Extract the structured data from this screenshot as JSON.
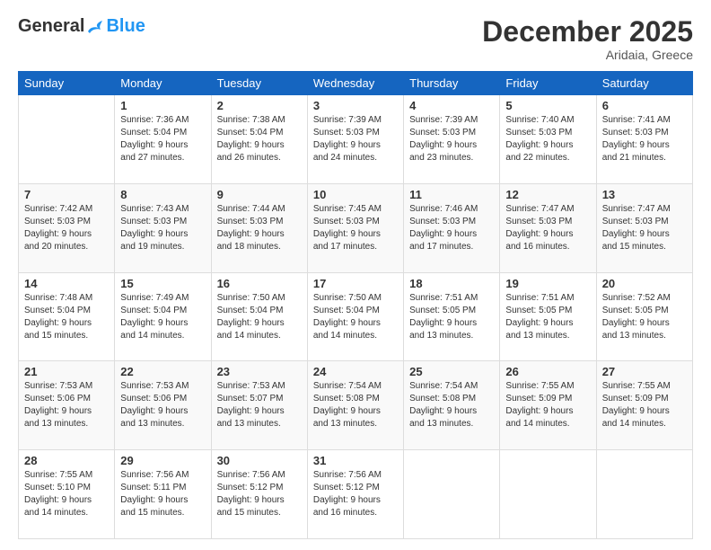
{
  "logo": {
    "general": "General",
    "blue": "Blue"
  },
  "header": {
    "month": "December 2025",
    "location": "Aridaia, Greece"
  },
  "weekdays": [
    "Sunday",
    "Monday",
    "Tuesday",
    "Wednesday",
    "Thursday",
    "Friday",
    "Saturday"
  ],
  "weeks": [
    [
      {
        "day": "",
        "info": ""
      },
      {
        "day": "1",
        "info": "Sunrise: 7:36 AM\nSunset: 5:04 PM\nDaylight: 9 hours\nand 27 minutes."
      },
      {
        "day": "2",
        "info": "Sunrise: 7:38 AM\nSunset: 5:04 PM\nDaylight: 9 hours\nand 26 minutes."
      },
      {
        "day": "3",
        "info": "Sunrise: 7:39 AM\nSunset: 5:03 PM\nDaylight: 9 hours\nand 24 minutes."
      },
      {
        "day": "4",
        "info": "Sunrise: 7:39 AM\nSunset: 5:03 PM\nDaylight: 9 hours\nand 23 minutes."
      },
      {
        "day": "5",
        "info": "Sunrise: 7:40 AM\nSunset: 5:03 PM\nDaylight: 9 hours\nand 22 minutes."
      },
      {
        "day": "6",
        "info": "Sunrise: 7:41 AM\nSunset: 5:03 PM\nDaylight: 9 hours\nand 21 minutes."
      }
    ],
    [
      {
        "day": "7",
        "info": "Sunrise: 7:42 AM\nSunset: 5:03 PM\nDaylight: 9 hours\nand 20 minutes."
      },
      {
        "day": "8",
        "info": "Sunrise: 7:43 AM\nSunset: 5:03 PM\nDaylight: 9 hours\nand 19 minutes."
      },
      {
        "day": "9",
        "info": "Sunrise: 7:44 AM\nSunset: 5:03 PM\nDaylight: 9 hours\nand 18 minutes."
      },
      {
        "day": "10",
        "info": "Sunrise: 7:45 AM\nSunset: 5:03 PM\nDaylight: 9 hours\nand 17 minutes."
      },
      {
        "day": "11",
        "info": "Sunrise: 7:46 AM\nSunset: 5:03 PM\nDaylight: 9 hours\nand 17 minutes."
      },
      {
        "day": "12",
        "info": "Sunrise: 7:47 AM\nSunset: 5:03 PM\nDaylight: 9 hours\nand 16 minutes."
      },
      {
        "day": "13",
        "info": "Sunrise: 7:47 AM\nSunset: 5:03 PM\nDaylight: 9 hours\nand 15 minutes."
      }
    ],
    [
      {
        "day": "14",
        "info": "Sunrise: 7:48 AM\nSunset: 5:04 PM\nDaylight: 9 hours\nand 15 minutes."
      },
      {
        "day": "15",
        "info": "Sunrise: 7:49 AM\nSunset: 5:04 PM\nDaylight: 9 hours\nand 14 minutes."
      },
      {
        "day": "16",
        "info": "Sunrise: 7:50 AM\nSunset: 5:04 PM\nDaylight: 9 hours\nand 14 minutes."
      },
      {
        "day": "17",
        "info": "Sunrise: 7:50 AM\nSunset: 5:04 PM\nDaylight: 9 hours\nand 14 minutes."
      },
      {
        "day": "18",
        "info": "Sunrise: 7:51 AM\nSunset: 5:05 PM\nDaylight: 9 hours\nand 13 minutes."
      },
      {
        "day": "19",
        "info": "Sunrise: 7:51 AM\nSunset: 5:05 PM\nDaylight: 9 hours\nand 13 minutes."
      },
      {
        "day": "20",
        "info": "Sunrise: 7:52 AM\nSunset: 5:05 PM\nDaylight: 9 hours\nand 13 minutes."
      }
    ],
    [
      {
        "day": "21",
        "info": "Sunrise: 7:53 AM\nSunset: 5:06 PM\nDaylight: 9 hours\nand 13 minutes."
      },
      {
        "day": "22",
        "info": "Sunrise: 7:53 AM\nSunset: 5:06 PM\nDaylight: 9 hours\nand 13 minutes."
      },
      {
        "day": "23",
        "info": "Sunrise: 7:53 AM\nSunset: 5:07 PM\nDaylight: 9 hours\nand 13 minutes."
      },
      {
        "day": "24",
        "info": "Sunrise: 7:54 AM\nSunset: 5:08 PM\nDaylight: 9 hours\nand 13 minutes."
      },
      {
        "day": "25",
        "info": "Sunrise: 7:54 AM\nSunset: 5:08 PM\nDaylight: 9 hours\nand 13 minutes."
      },
      {
        "day": "26",
        "info": "Sunrise: 7:55 AM\nSunset: 5:09 PM\nDaylight: 9 hours\nand 14 minutes."
      },
      {
        "day": "27",
        "info": "Sunrise: 7:55 AM\nSunset: 5:09 PM\nDaylight: 9 hours\nand 14 minutes."
      }
    ],
    [
      {
        "day": "28",
        "info": "Sunrise: 7:55 AM\nSunset: 5:10 PM\nDaylight: 9 hours\nand 14 minutes."
      },
      {
        "day": "29",
        "info": "Sunrise: 7:56 AM\nSunset: 5:11 PM\nDaylight: 9 hours\nand 15 minutes."
      },
      {
        "day": "30",
        "info": "Sunrise: 7:56 AM\nSunset: 5:12 PM\nDaylight: 9 hours\nand 15 minutes."
      },
      {
        "day": "31",
        "info": "Sunrise: 7:56 AM\nSunset: 5:12 PM\nDaylight: 9 hours\nand 16 minutes."
      },
      {
        "day": "",
        "info": ""
      },
      {
        "day": "",
        "info": ""
      },
      {
        "day": "",
        "info": ""
      }
    ]
  ]
}
